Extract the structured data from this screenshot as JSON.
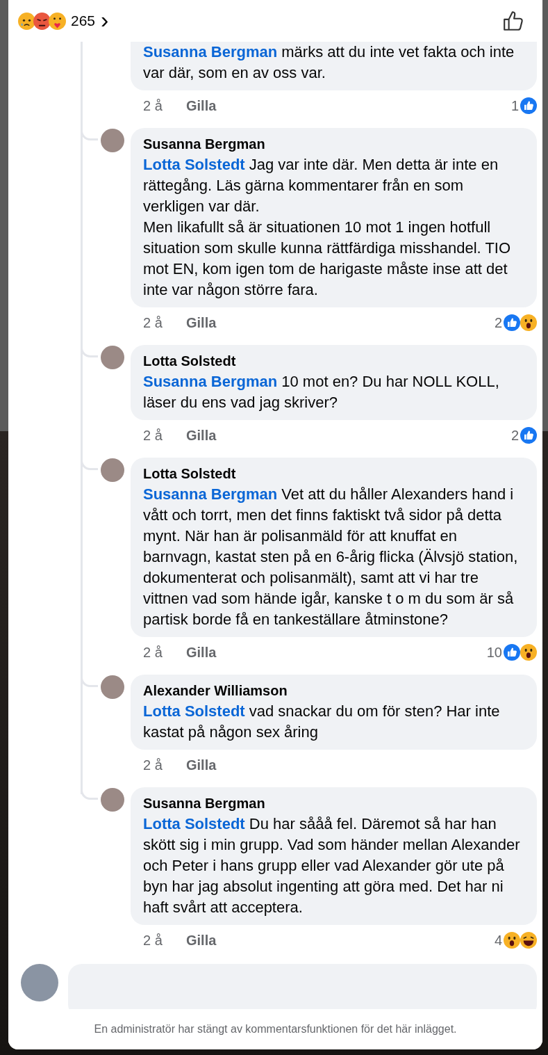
{
  "header": {
    "reactions": [
      {
        "kind": "sad"
      },
      {
        "kind": "angry"
      },
      {
        "kind": "care"
      }
    ],
    "count": "265",
    "chevron": "›"
  },
  "replies": [
    {
      "mention": "Susanna Bergman",
      "text": "märks att du inte vet fakta och inte var där, som en av oss var.",
      "time": "2 å",
      "like_label": "Gilla",
      "reaction_count": "1",
      "reactions": [
        {
          "kind": "like"
        }
      ]
    },
    {
      "author": "Susanna Bergman",
      "mention": "Lotta Solstedt",
      "text": "Jag var inte där. Men detta är inte en rättegång. Läs gärna kommentarer från en som verkligen var där.\nMen likafullt så är situationen 10 mot 1 ingen hotfull situation som skulle kunna rättfärdiga misshandel. TIO mot EN, kom igen tom de harigaste måste inse att det inte var någon större fara.",
      "time": "2 å",
      "like_label": "Gilla",
      "reaction_count": "2",
      "reactions": [
        {
          "kind": "like"
        },
        {
          "kind": "wow"
        }
      ]
    },
    {
      "author": "Lotta Solstedt",
      "mention": "Susanna Bergman",
      "text": "10 mot en? Du har NOLL KOLL, läser du ens vad jag skriver?",
      "time": "2 å",
      "like_label": "Gilla",
      "reaction_count": "2",
      "reactions": [
        {
          "kind": "like"
        }
      ]
    },
    {
      "author": "Lotta Solstedt",
      "mention": "Susanna Bergman",
      "text": "Vet att du håller Alexanders hand i vått och torrt, men det finns faktiskt två sidor på detta  mynt. När han är polisanmäld för att knuffat en barnvagn, kastat sten på en 6-årig flicka (Älvsjö station, dokumenterat och polisanmält), samt att vi har tre vittnen vad som hände igår, kanske t o m du som är så partisk borde få en tankeställare  åtminstone?",
      "time": "2 å",
      "like_label": "Gilla",
      "reaction_count": "10",
      "reactions": [
        {
          "kind": "like"
        },
        {
          "kind": "wow"
        }
      ]
    },
    {
      "author": "Alexander Williamson",
      "mention": "Lotta Solstedt",
      "text": "vad snackar du om för sten? Har inte kastat på någon sex åring",
      "time": "2 å",
      "like_label": "Gilla"
    },
    {
      "author": "Susanna Bergman",
      "mention": "Lotta Solstedt",
      "text": "Du har sååå fel. Däremot så har han skött sig i min grupp. Vad som händer mellan Alexander och Peter i hans grupp eller vad Alexander gör ute på byn har jag absolut ingenting att göra med. Det har ni haft svårt att acceptera.",
      "time": "2 å",
      "like_label": "Gilla",
      "reaction_count": "4",
      "reactions": [
        {
          "kind": "wow"
        },
        {
          "kind": "haha"
        }
      ]
    }
  ],
  "footer": {
    "notice": "En administratör har stängt av kommentarsfunktionen för det här inlägget."
  }
}
